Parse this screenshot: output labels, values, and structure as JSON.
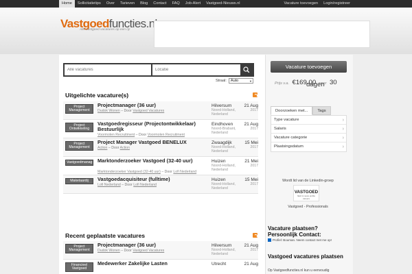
{
  "nav": {
    "left": [
      "Home",
      "Sollicitatietips",
      "Over",
      "Tarieven",
      "Blog",
      "Contact",
      "FAQ",
      "Job-Alert",
      "Vastgoed-Nieuws.nl"
    ],
    "right": [
      "Vacature toevoegen",
      "Login/registreer"
    ]
  },
  "logo": {
    "main": "Vastgoed",
    "rest": "functies.nl",
    "tagline": "Alle vastgoed vacatures op een rij!"
  },
  "search": {
    "vacatures_placeholder": "Alle vacatures",
    "locatie_placeholder": "Locatie",
    "sort_label": "Straal:",
    "sort_value": "Auto"
  },
  "featured": {
    "title": "Uitgelichte vacature(s)",
    "jobs": [
      {
        "category": "Project\nManagement",
        "title": "Projectmanager (36 uur)",
        "company": "Dudok Wonen",
        "by": "– Door",
        "poster": "Vastgoed Vacatures",
        "location": "Hilversum",
        "region": "Noord-Holland, Nederland",
        "date": "21 Aug",
        "year": "2017"
      },
      {
        "category": "Project\nOntwikkeling",
        "title": "Vastgoedregisseur (Projectontwikkelaar) Bestuurlijk",
        "company": "Voormolen Recruitment",
        "by": "– Door",
        "poster": "Voormolen Recruitment",
        "location": "Eindhoven",
        "region": "Noord-Brabant, Nederland",
        "date": "21 Aug",
        "year": "2017"
      },
      {
        "category": "Project\nManagement",
        "title": "Project Manager Vastgoed BENELUX",
        "company": "Action",
        "by": "– Door",
        "poster": "Action",
        "location": "Zwaagdijk",
        "region": "Noord-Holland, Nederland",
        "date": "15 Mei",
        "year": "2017"
      },
      {
        "category": "Vastgoedmanag",
        "title": "Marktonderzoeker Vastgoed (32-40 uur)",
        "company": "Marktonderzoeker Vastgoed (32-40 uur)",
        "by": "– Door",
        "poster": "Lofi Nederland",
        "location": "Huizen",
        "region": "Noord-Holland, Nederland",
        "date": "21 Mei",
        "year": "2017"
      },
      {
        "category": "Makelaardij",
        "title": "Vastgoedacquisiteur (fulltime)",
        "company": "Lofi Nederland",
        "by": "– Door",
        "poster": "Lofi Nederland",
        "location": "Huizen",
        "region": "Noord-Holland, Nederland",
        "date": "15 Mei",
        "year": "2017"
      }
    ]
  },
  "recent": {
    "title": "Recent geplaatste vacatures",
    "jobs": [
      {
        "category": "Project\nManagement",
        "title": "Projectmanager (36 uur)",
        "company": "Dudok Wonen",
        "by": "– Door",
        "poster": "Vastgoed Vacatures",
        "location": "Hilversum",
        "region": "Noord-Holland, Nederland",
        "date": "21 Aug",
        "year": "2017"
      },
      {
        "category": "Financieel\nVastgoed",
        "title": "Medewerker Zakelijke Lasten",
        "company": "",
        "by": "",
        "poster": "",
        "location": "Utrecht",
        "region": "",
        "date": "21 Aug",
        "year": ""
      }
    ]
  },
  "sidebar": {
    "post_button": "Vacature toevoegen",
    "price_prefix": "Prijs v.a.",
    "price": "€169.00",
    "price_mid": "voor",
    "price_days_num": "30",
    "price_days": "dagen",
    "tabs": [
      "Doorzoeken met...",
      "Tags"
    ],
    "filters": [
      "Type vacature",
      "Salaris",
      "Vacature categorie",
      "Plaatsingsdatum"
    ],
    "linkedin_text": "Wordt lid van de Linkedin-groep",
    "linkedin_logo": "VASTGOED",
    "linkedin_logo_sub": "flash & news profile careers",
    "linkedin_caption": "Vastgoed - Professionals",
    "contact_title": "Vacature plaatsen? Persoonlijk Contact:",
    "contact_line": "Profiel: Bouman. Neem contact met me op!",
    "vac_title": "Vastgoed vacatures plaatsen",
    "vac_text": "Op Vastgoedfuncties.nl kun u eenvoudig"
  },
  "colors": {
    "accent": "#e06b10",
    "topbar": "#2d2d2d",
    "category_bg": "#6a6a6a",
    "rss": "#f08a24"
  }
}
